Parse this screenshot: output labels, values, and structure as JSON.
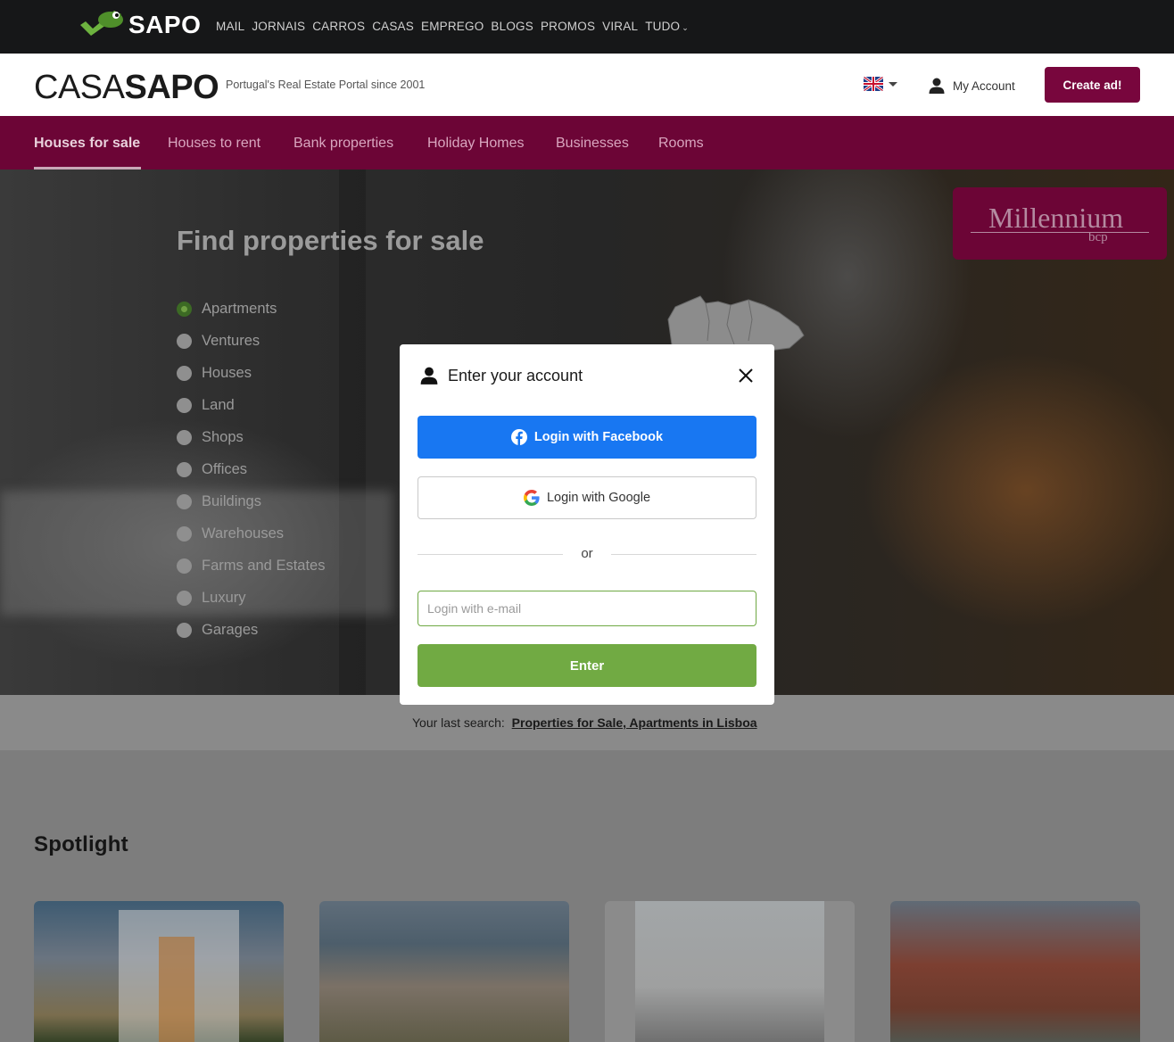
{
  "sapo_bar": {
    "logo_text": "SAPO",
    "links": [
      "MAIL",
      "JORNAIS",
      "CARROS",
      "CASAS",
      "EMPREGO",
      "BLOGS",
      "PROMOS",
      "VIRAL",
      "TUDO"
    ]
  },
  "header": {
    "brand_part1": "CASA",
    "brand_part2": "SAPO",
    "tagline": "Portugal's Real Estate Portal since 2001",
    "language_icon": "uk-flag-icon",
    "account_label": "My Account",
    "create_ad_label": "Create ad!"
  },
  "nav": {
    "items": [
      {
        "label": "Houses for sale",
        "active": true
      },
      {
        "label": "Houses to rent",
        "active": false
      },
      {
        "label": "Bank properties",
        "active": false
      },
      {
        "label": "Holiday Homes",
        "active": false
      },
      {
        "label": "Businesses",
        "active": false
      },
      {
        "label": "Rooms",
        "active": false
      }
    ]
  },
  "hero": {
    "title": "Find properties for sale",
    "property_types": [
      {
        "label": "Apartments",
        "selected": true
      },
      {
        "label": "Ventures",
        "selected": false
      },
      {
        "label": "Houses",
        "selected": false
      },
      {
        "label": "Land",
        "selected": false
      },
      {
        "label": "Shops",
        "selected": false
      },
      {
        "label": "Offices",
        "selected": false
      },
      {
        "label": "Buildings",
        "selected": false
      },
      {
        "label": "Warehouses",
        "selected": false
      },
      {
        "label": "Farms and Estates",
        "selected": false
      },
      {
        "label": "Luxury",
        "selected": false
      },
      {
        "label": "Garages",
        "selected": false
      }
    ],
    "ad": {
      "name": "Millennium",
      "sub": "bcp"
    }
  },
  "last_search": {
    "label": "Your last search:",
    "link": "Properties for Sale, Apartments in Lisboa"
  },
  "spotlight": {
    "title": "Spotlight"
  },
  "modal": {
    "title": "Enter your account",
    "facebook_label": "Login with Facebook",
    "google_label": "Login with Google",
    "or_text": "or",
    "email_placeholder": "Login with e-mail",
    "email_value": "",
    "enter_label": "Enter"
  },
  "colors": {
    "brand_magenta": "#6c0536",
    "create_button": "#78063d",
    "facebook_blue": "#1877f2",
    "enter_green": "#71aa43"
  }
}
